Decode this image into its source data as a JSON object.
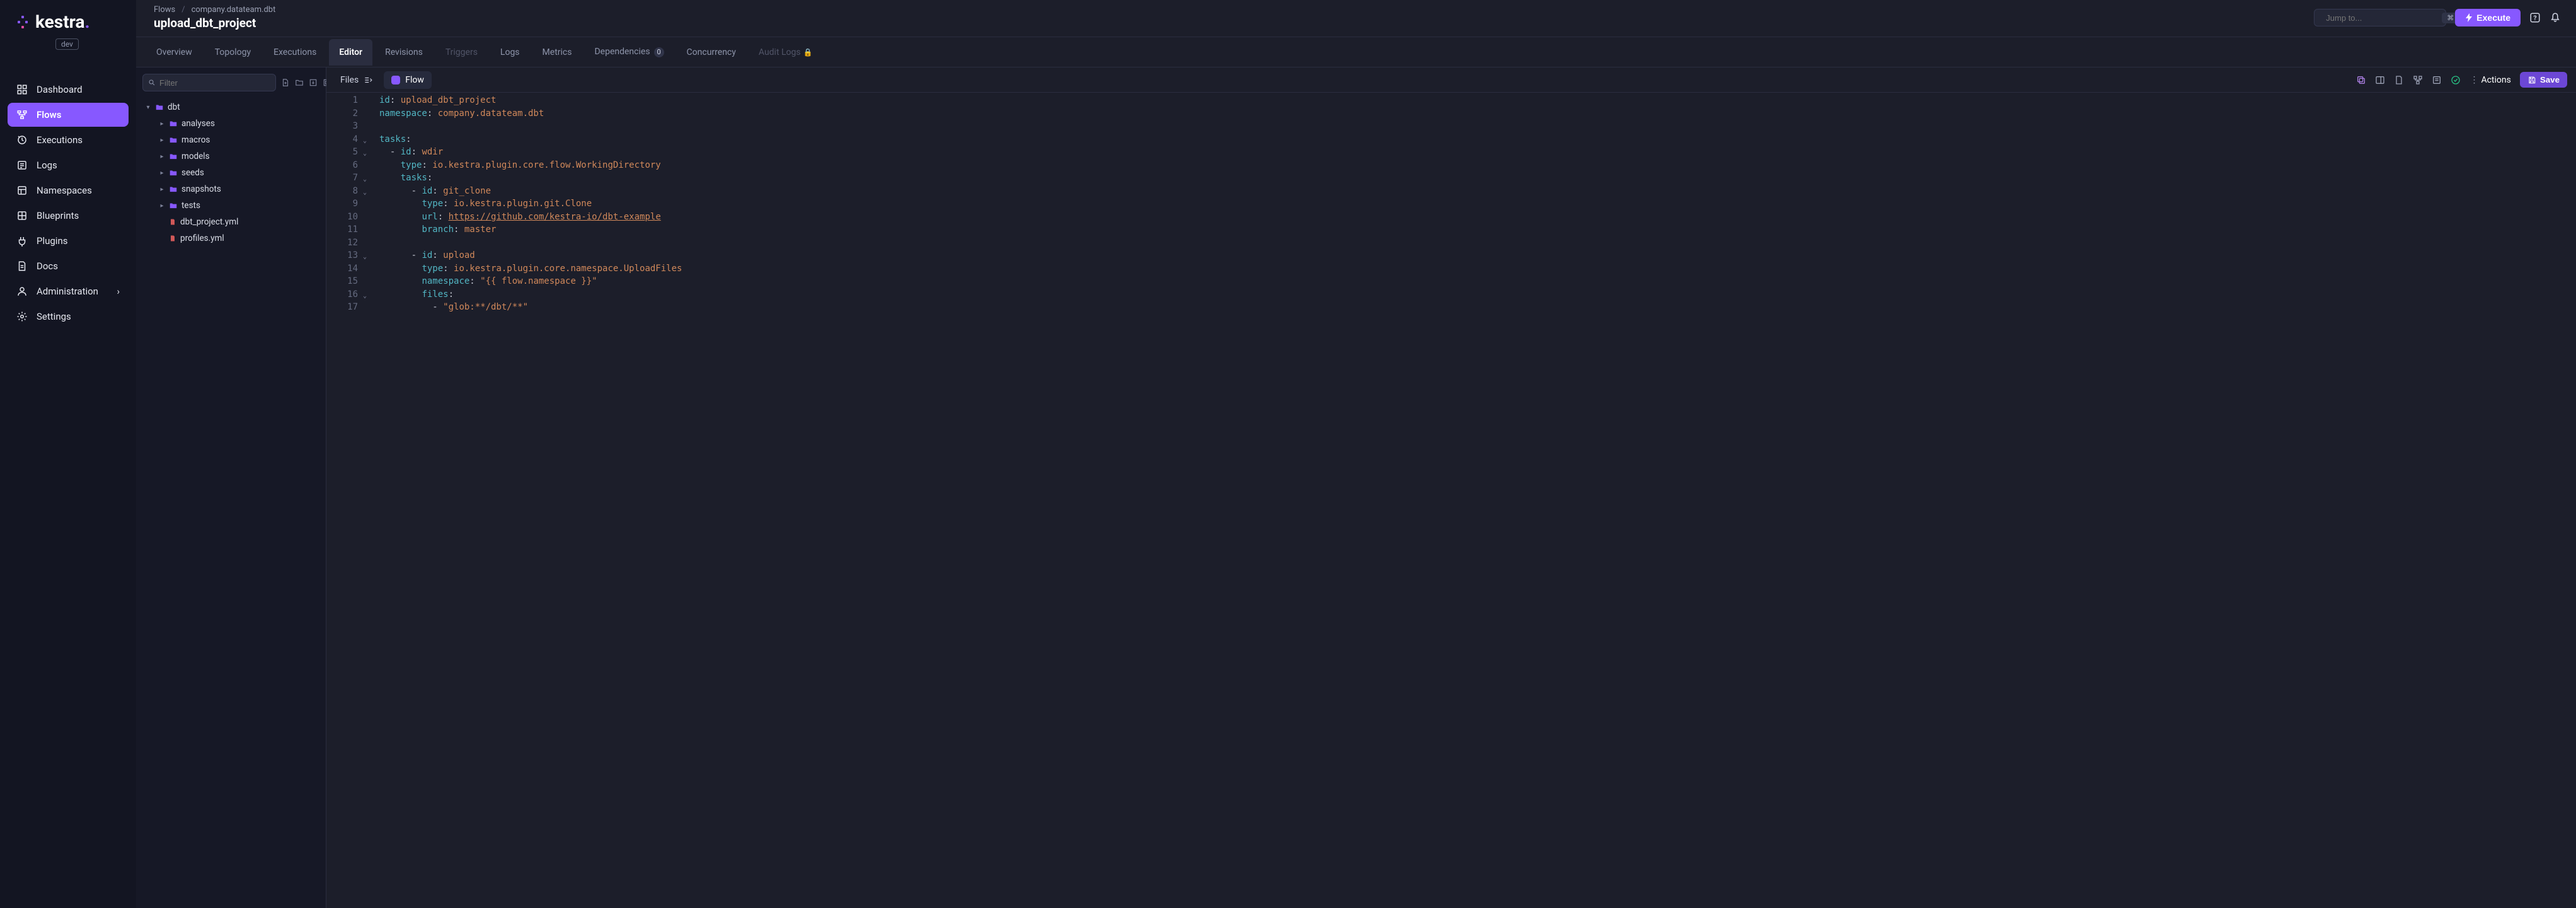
{
  "logo": {
    "name": "kestra",
    "badge": "dev"
  },
  "breadcrumb": {
    "root": "Flows",
    "namespace": "company.datateam.dbt"
  },
  "page_title": "upload_dbt_project",
  "search": {
    "placeholder": "Jump to...",
    "hint": "Ctrl/Cmd + K"
  },
  "execute_label": "Execute",
  "nav": [
    {
      "label": "Dashboard",
      "icon": "dashboard-icon"
    },
    {
      "label": "Flows",
      "icon": "flows-icon",
      "active": true
    },
    {
      "label": "Executions",
      "icon": "executions-icon"
    },
    {
      "label": "Logs",
      "icon": "logs-icon"
    },
    {
      "label": "Namespaces",
      "icon": "namespaces-icon"
    },
    {
      "label": "Blueprints",
      "icon": "blueprints-icon"
    },
    {
      "label": "Plugins",
      "icon": "plugins-icon"
    },
    {
      "label": "Docs",
      "icon": "docs-icon"
    },
    {
      "label": "Administration",
      "icon": "administration-icon",
      "chevron": true
    },
    {
      "label": "Settings",
      "icon": "settings-icon"
    }
  ],
  "tabs": {
    "overview": "Overview",
    "topology": "Topology",
    "executions": "Executions",
    "editor": "Editor",
    "revisions": "Revisions",
    "triggers": "Triggers",
    "logs": "Logs",
    "metrics": "Metrics",
    "dependencies": "Dependencies",
    "dependencies_count": "0",
    "concurrency": "Concurrency",
    "audit_logs": "Audit Logs"
  },
  "filter_placeholder": "Filter",
  "file_tree": {
    "root": "dbt",
    "folders": [
      "analyses",
      "macros",
      "models",
      "seeds",
      "snapshots",
      "tests"
    ],
    "files": [
      "dbt_project.yml",
      "profiles.yml"
    ]
  },
  "editor_tabs": {
    "files": "Files",
    "flow": "Flow"
  },
  "editor_actions": {
    "actions": "Actions",
    "save": "Save"
  },
  "code": {
    "lines": [
      {
        "n": 1,
        "segs": [
          [
            "key",
            "id"
          ],
          [
            "colon",
            ": "
          ],
          [
            "str",
            "upload_dbt_project"
          ]
        ]
      },
      {
        "n": 2,
        "segs": [
          [
            "key",
            "namespace"
          ],
          [
            "colon",
            ": "
          ],
          [
            "str",
            "company.datateam.dbt"
          ]
        ]
      },
      {
        "n": 3,
        "segs": []
      },
      {
        "n": 4,
        "fold": true,
        "segs": [
          [
            "key",
            "tasks"
          ],
          [
            "colon",
            ":"
          ]
        ]
      },
      {
        "n": 5,
        "fold": true,
        "indent": 2,
        "segs": [
          [
            "dash",
            "- "
          ],
          [
            "key",
            "id"
          ],
          [
            "colon",
            ": "
          ],
          [
            "str",
            "wdir"
          ]
        ]
      },
      {
        "n": 6,
        "indent": 4,
        "segs": [
          [
            "key",
            "type"
          ],
          [
            "colon",
            ": "
          ],
          [
            "str",
            "io.kestra.plugin.core.flow.WorkingDirectory"
          ]
        ]
      },
      {
        "n": 7,
        "fold": true,
        "indent": 4,
        "segs": [
          [
            "key",
            "tasks"
          ],
          [
            "colon",
            ":"
          ]
        ]
      },
      {
        "n": 8,
        "fold": true,
        "indent": 6,
        "segs": [
          [
            "dash",
            "- "
          ],
          [
            "key",
            "id"
          ],
          [
            "colon",
            ": "
          ],
          [
            "str",
            "git_clone"
          ]
        ]
      },
      {
        "n": 9,
        "indent": 8,
        "segs": [
          [
            "key",
            "type"
          ],
          [
            "colon",
            ": "
          ],
          [
            "str",
            "io.kestra.plugin.git.Clone"
          ]
        ]
      },
      {
        "n": 10,
        "indent": 8,
        "segs": [
          [
            "key",
            "url"
          ],
          [
            "colon",
            ": "
          ],
          [
            "link",
            "https://github.com/kestra-io/dbt-example"
          ]
        ]
      },
      {
        "n": 11,
        "indent": 8,
        "segs": [
          [
            "key",
            "branch"
          ],
          [
            "colon",
            ": "
          ],
          [
            "str",
            "master"
          ]
        ]
      },
      {
        "n": 12,
        "segs": []
      },
      {
        "n": 13,
        "fold": true,
        "indent": 6,
        "segs": [
          [
            "dash",
            "- "
          ],
          [
            "key",
            "id"
          ],
          [
            "colon",
            ": "
          ],
          [
            "str",
            "upload"
          ]
        ]
      },
      {
        "n": 14,
        "indent": 8,
        "segs": [
          [
            "key",
            "type"
          ],
          [
            "colon",
            ": "
          ],
          [
            "str",
            "io.kestra.plugin.core.namespace.UploadFiles"
          ]
        ]
      },
      {
        "n": 15,
        "indent": 8,
        "segs": [
          [
            "key",
            "namespace"
          ],
          [
            "colon",
            ": "
          ],
          [
            "str",
            "\"{{ flow.namespace }}\""
          ]
        ]
      },
      {
        "n": 16,
        "fold": true,
        "indent": 8,
        "segs": [
          [
            "key",
            "files"
          ],
          [
            "colon",
            ":"
          ]
        ]
      },
      {
        "n": 17,
        "indent": 10,
        "segs": [
          [
            "dash",
            "- "
          ],
          [
            "str",
            "\"glob:**/dbt/**\""
          ]
        ]
      }
    ]
  }
}
